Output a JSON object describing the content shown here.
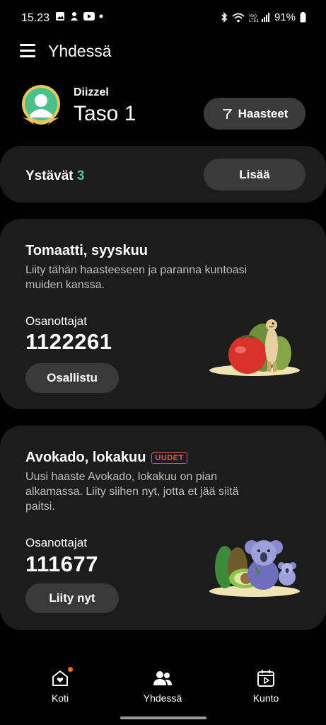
{
  "status_bar": {
    "time": "15.23",
    "battery": "91%",
    "network": "VoLTE1"
  },
  "header": {
    "title": "Yhdessä"
  },
  "profile": {
    "username": "Diizzel",
    "level": "Taso 1",
    "challenges_button": "Haasteet"
  },
  "friends": {
    "label": "Ystävät",
    "count": "3",
    "add_button": "Lisää"
  },
  "challenges": [
    {
      "title": "Tomaatti, syyskuu",
      "badge": "",
      "description": "Liity tähän haasteeseen ja paranna kuntoasi muiden kanssa.",
      "participants_label": "Osanottajat",
      "participants": "1122261",
      "button": "Osallistu"
    },
    {
      "title": "Avokado, lokakuu",
      "badge": "UUDET",
      "description": "Uusi haaste Avokado, lokakuu on pian alkamassa. Liity siihen nyt, jotta et jää siitä paitsi.",
      "participants_label": "Osanottajat",
      "participants": "111677",
      "button": "Liity nyt"
    }
  ],
  "bottom_nav": {
    "items": [
      {
        "label": "Koti",
        "icon": "home-heart-icon",
        "has_notification": true
      },
      {
        "label": "Yhdessä",
        "icon": "people-icon",
        "active": true
      },
      {
        "label": "Kunto",
        "icon": "fitness-play-icon"
      }
    ]
  },
  "colors": {
    "background": "#000000",
    "card": "#1c1c1c",
    "button": "#3a3a3a",
    "friends_count": "#4cc38a",
    "new_badge": "#e05a4e",
    "notification_dot": "#f26a2e"
  }
}
